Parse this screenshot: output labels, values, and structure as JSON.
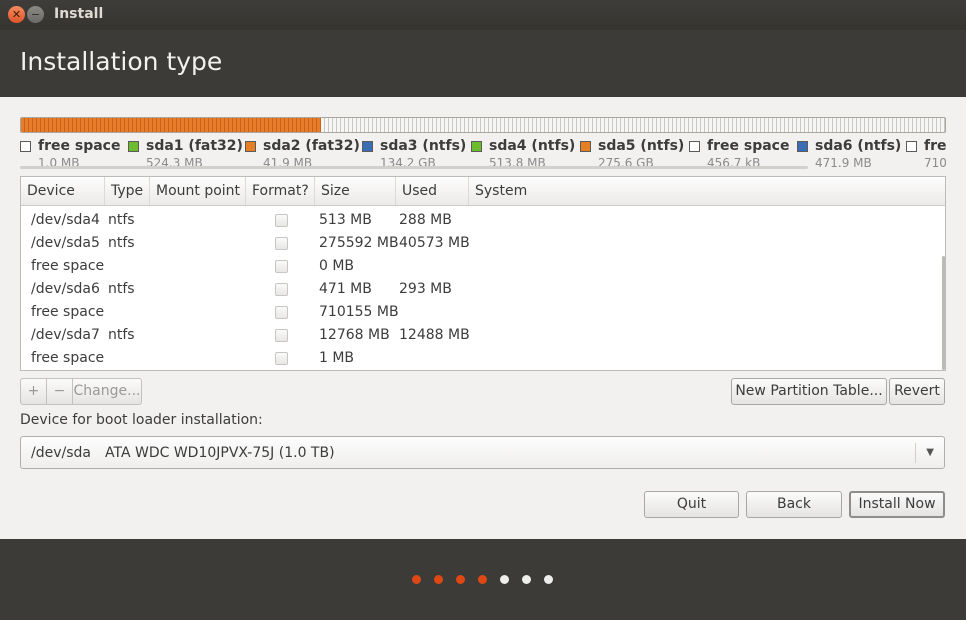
{
  "window": {
    "title": "Install"
  },
  "page": {
    "title": "Installation type"
  },
  "legend": [
    {
      "name": "free space",
      "size": "1.0 MB",
      "color": "#ffffff"
    },
    {
      "name": "sda1 (fat32)",
      "size": "524.3 MB",
      "color": "#6cbc2d"
    },
    {
      "name": "sda2 (fat32)",
      "size": "41.9 MB",
      "color": "#e67e22"
    },
    {
      "name": "sda3 (ntfs)",
      "size": "134.2 GB",
      "color": "#3a6db4"
    },
    {
      "name": "sda4 (ntfs)",
      "size": "513.8 MB",
      "color": "#6cbc2d"
    },
    {
      "name": "sda5 (ntfs)",
      "size": "275.6 GB",
      "color": "#e67e22"
    },
    {
      "name": "free space",
      "size": "456.7 kB",
      "color": "#ffffff"
    },
    {
      "name": "sda6 (ntfs)",
      "size": "471.9 MB",
      "color": "#3a6db4"
    },
    {
      "name": "free space",
      "size": "710",
      "color": "#ffffff"
    }
  ],
  "table": {
    "headers": [
      "Device",
      "Type",
      "Mount point",
      "Format?",
      "Size",
      "Used",
      "System"
    ],
    "rows": [
      {
        "device": "/dev/sda4",
        "type": "ntfs",
        "mount": "",
        "size": "513 MB",
        "used": "288 MB",
        "system": ""
      },
      {
        "device": "/dev/sda5",
        "type": "ntfs",
        "mount": "",
        "size": "275592 MB",
        "used": "40573 MB",
        "system": ""
      },
      {
        "device": "free space",
        "type": "",
        "mount": "",
        "size": "0 MB",
        "used": "",
        "system": ""
      },
      {
        "device": "/dev/sda6",
        "type": "ntfs",
        "mount": "",
        "size": "471 MB",
        "used": "293 MB",
        "system": ""
      },
      {
        "device": "free space",
        "type": "",
        "mount": "",
        "size": "710155 MB",
        "used": "",
        "system": ""
      },
      {
        "device": "/dev/sda7",
        "type": "ntfs",
        "mount": "",
        "size": "12768 MB",
        "used": "12488 MB",
        "system": ""
      },
      {
        "device": "free space",
        "type": "",
        "mount": "",
        "size": "1 MB",
        "used": "",
        "system": ""
      }
    ]
  },
  "actions": {
    "add": "+",
    "remove": "−",
    "change": "Change...",
    "new_table": "New Partition Table...",
    "revert": "Revert"
  },
  "bootloader": {
    "label": "Device for boot loader installation:",
    "device": "/dev/sda",
    "model": "ATA WDC WD10JPVX-75J (1.0 TB)"
  },
  "nav": {
    "quit": "Quit",
    "back": "Back",
    "install": "Install Now"
  },
  "progress": {
    "total_steps": 7,
    "current_step": 4,
    "done_color": "#dd4814",
    "todo_color": "#eeeeec"
  }
}
